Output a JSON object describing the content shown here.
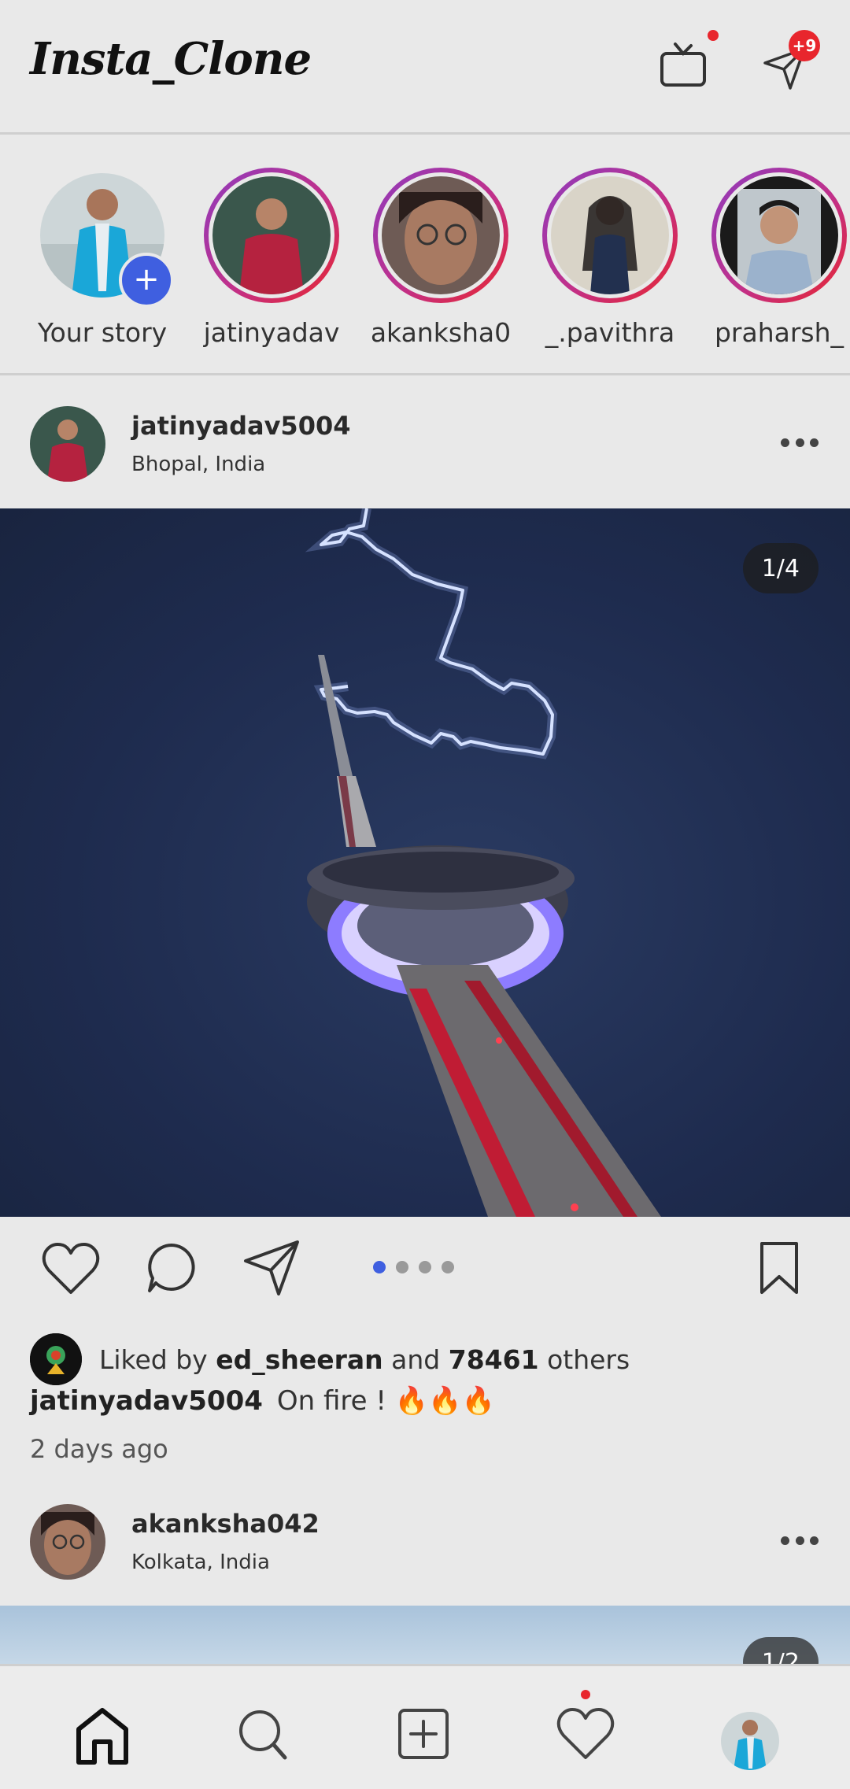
{
  "app": {
    "title": "Insta_Clone",
    "notif_badge": "+9"
  },
  "stories": [
    {
      "label": "Your story"
    },
    {
      "label": "jatinyadav"
    },
    {
      "label": "akanksha0"
    },
    {
      "label": "_.pavithra"
    },
    {
      "label": "praharsh_"
    }
  ],
  "post1": {
    "username": "jatinyadav5004",
    "location": "Bhopal, India",
    "counter": "1/4",
    "liked_by_prefix": "Liked by",
    "liked_by_user": "ed_sheeran",
    "liked_by_and": "and",
    "likes_count": "78461",
    "likes_suffix": "others",
    "caption_user": "jatinyadav5004",
    "caption_text": "On fire ! 🔥🔥🔥",
    "time_ago": "2 days ago",
    "carousel_pages": 4,
    "carousel_active": 1
  },
  "post2": {
    "username": "akanksha042",
    "location": "Kolkata, India",
    "counter": "1/2"
  },
  "colors": {
    "accent": "#3f5fe0",
    "badge": "#e8262d",
    "story_ring_start": "#8e3bbd",
    "story_ring_end": "#e8262d"
  },
  "icons": {
    "top": [
      "tv-icon",
      "send-icon"
    ],
    "actions": [
      "heart-icon",
      "comment-icon",
      "share-icon",
      "bookmark-icon"
    ],
    "nav": [
      "home-icon",
      "search-icon",
      "add-post-icon",
      "activity-heart-icon",
      "profile-avatar"
    ]
  }
}
